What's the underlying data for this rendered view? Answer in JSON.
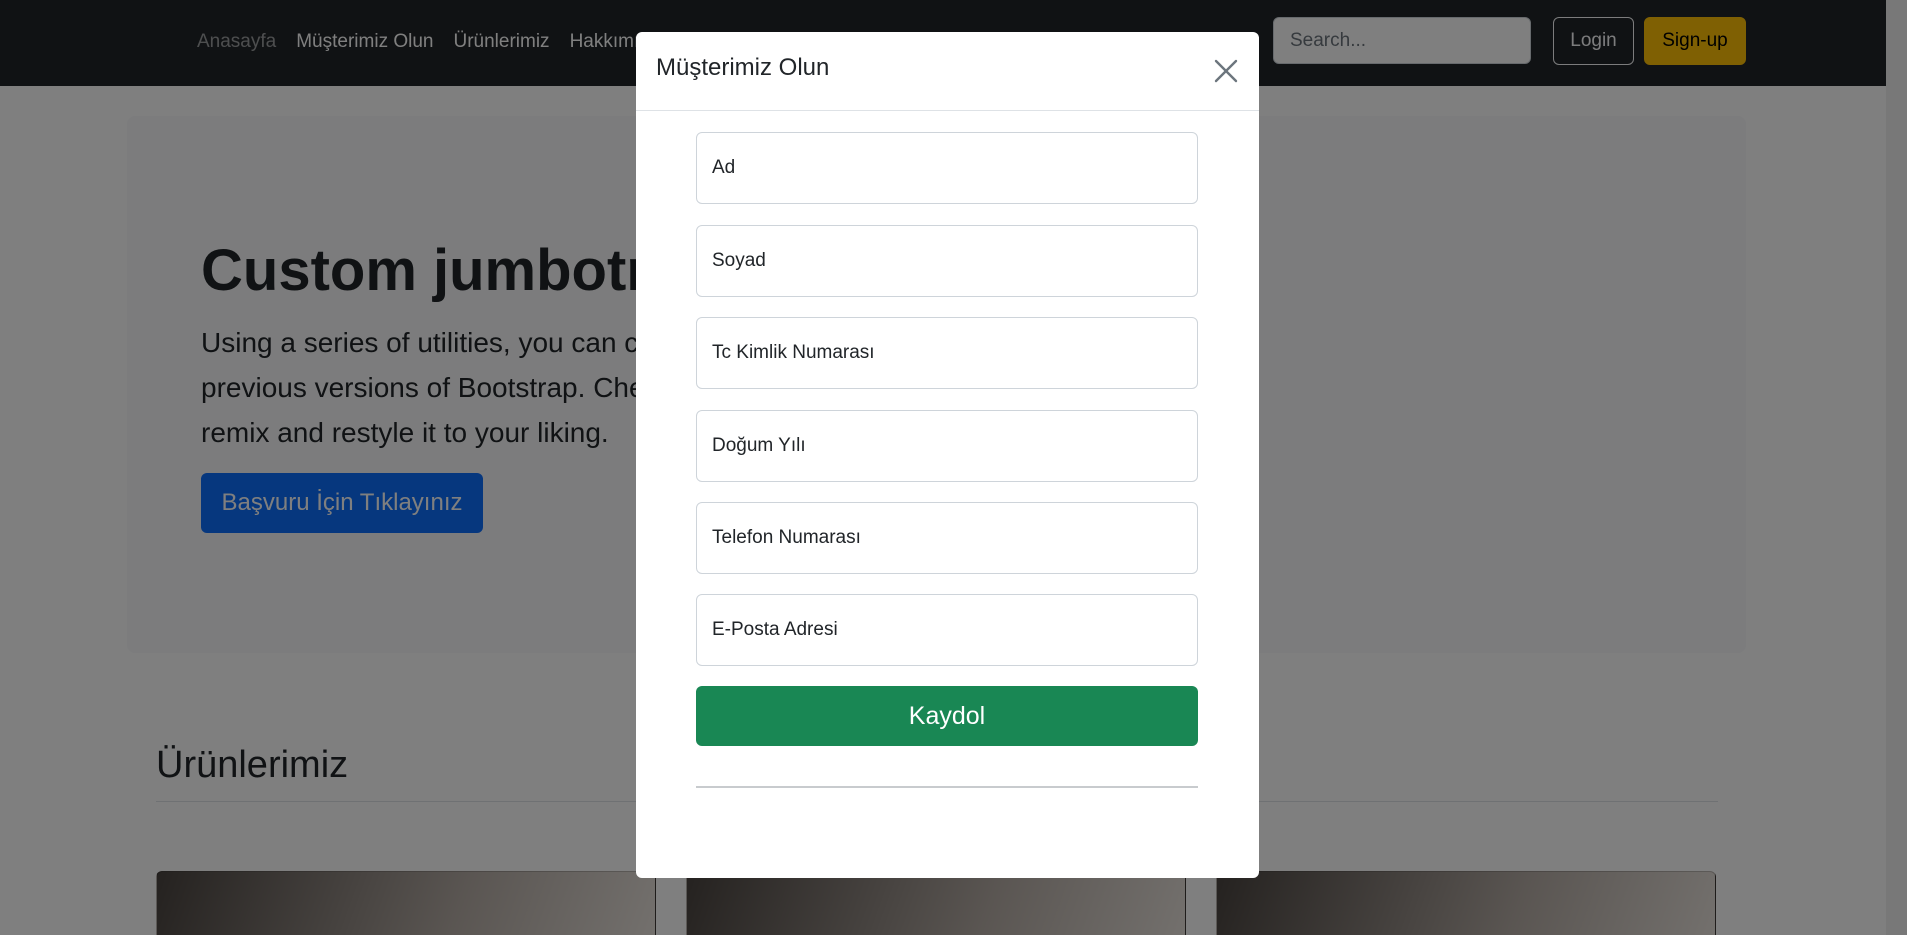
{
  "navbar": {
    "links": [
      {
        "label": "Anasayfa",
        "active": true
      },
      {
        "label": "Müşterimiz Olun",
        "active": false
      },
      {
        "label": "Ürünlerimiz",
        "active": false
      },
      {
        "label": "Hakkımızda",
        "active": false
      }
    ],
    "search_placeholder": "Search...",
    "login_label": "Login",
    "signup_label": "Sign-up"
  },
  "jumbotron": {
    "title": "Custom jumbotron",
    "lead": "Using a series of utilities, you can create this jumbotron, just like the one in previous versions of Bootstrap. Check out the examples below for how you can remix and restyle it to your liking.",
    "button_label": "Başvuru İçin Tıklayınız"
  },
  "products": {
    "title": "Ürünlerimiz"
  },
  "modal": {
    "title": "Müşterimiz Olun",
    "close_icon": "close-icon",
    "fields": [
      {
        "placeholder": "Ad",
        "value": ""
      },
      {
        "placeholder": "Soyad",
        "value": ""
      },
      {
        "placeholder": "Tc Kimlik Numarası",
        "value": ""
      },
      {
        "placeholder": "Doğum Yılı",
        "value": ""
      },
      {
        "placeholder": "Telefon Numarası",
        "value": ""
      },
      {
        "placeholder": "E-Posta Adresi",
        "value": ""
      }
    ],
    "submit_label": "Kaydol"
  },
  "colors": {
    "navbar_bg": "#212529",
    "primary": "#0d6efd",
    "success": "#198754",
    "warning": "#ffc107"
  }
}
